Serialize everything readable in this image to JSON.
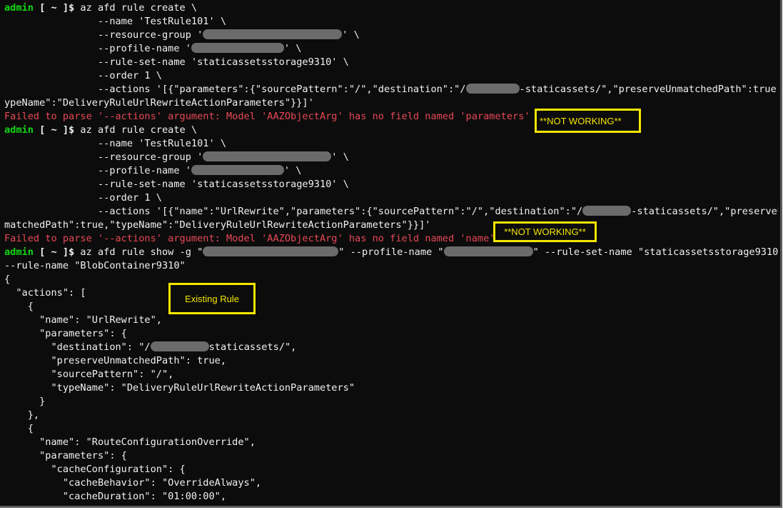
{
  "terminal": {
    "lines": [
      {
        "segments": [
          {
            "t": "admin",
            "c": "user"
          },
          {
            "t": " [ ~ ]$ ",
            "c": "prompt"
          },
          {
            "t": "az afd rule create \\"
          }
        ]
      },
      {
        "segments": [
          {
            "t": "                --name 'TestRule101' \\"
          }
        ]
      },
      {
        "segments": [
          {
            "t": "                --resource-group '"
          },
          {
            "redact": 195
          },
          {
            "t": "' \\"
          }
        ]
      },
      {
        "segments": [
          {
            "t": "                --profile-name '"
          },
          {
            "redact": 130
          },
          {
            "t": "' \\"
          }
        ]
      },
      {
        "segments": [
          {
            "t": "                --rule-set-name 'staticassetsstorage9310' \\"
          }
        ]
      },
      {
        "segments": [
          {
            "t": "                --order 1 \\"
          }
        ]
      },
      {
        "segments": [
          {
            "t": "                --actions '[{\"parameters\":{\"sourcePattern\":\"/\",\"destination\":\"/"
          },
          {
            "redact": 75
          },
          {
            "t": "-staticassets/\",\"preserveUnmatchedPath\":true,\"t"
          }
        ]
      },
      {
        "segments": [
          {
            "t": "ypeName\":\"DeliveryRuleUrlRewriteActionParameters\"}}]'"
          }
        ]
      },
      {
        "segments": [
          {
            "t": "Failed to parse '--actions' argument: Model 'AAZObjectArg' has no field named 'parameters'",
            "c": "err"
          }
        ]
      },
      {
        "segments": [
          {
            "t": "admin",
            "c": "user"
          },
          {
            "t": " [ ~ ]$ ",
            "c": "prompt"
          },
          {
            "t": "az afd rule create \\"
          }
        ]
      },
      {
        "segments": [
          {
            "t": "                --name 'TestRule101' \\"
          }
        ]
      },
      {
        "segments": [
          {
            "t": "                --resource-group '"
          },
          {
            "redact": 180
          },
          {
            "t": "' \\"
          }
        ]
      },
      {
        "segments": [
          {
            "t": "                --profile-name '"
          },
          {
            "redact": 130
          },
          {
            "t": "' \\"
          }
        ]
      },
      {
        "segments": [
          {
            "t": "                --rule-set-name 'staticassetsstorage9310' \\"
          }
        ]
      },
      {
        "segments": [
          {
            "t": "                --order 1 \\"
          }
        ]
      },
      {
        "segments": [
          {
            "t": "                --actions '[{\"name\":\"UrlRewrite\",\"parameters\":{\"sourcePattern\":\"/\",\"destination\":\"/"
          },
          {
            "redact": 68
          },
          {
            "t": "-staticassets/\",\"preserveUn"
          }
        ]
      },
      {
        "segments": [
          {
            "t": "matchedPath\":true,\"typeName\":\"DeliveryRuleUrlRewriteActionParameters\"}}]'"
          }
        ]
      },
      {
        "segments": [
          {
            "t": "Failed to parse '--actions' argument: Model 'AAZObjectArg' has no field named 'name'",
            "c": "err"
          }
        ]
      },
      {
        "segments": [
          {
            "t": "admin",
            "c": "user"
          },
          {
            "t": " [ ~ ]$ ",
            "c": "prompt"
          },
          {
            "t": "az afd rule show -g \""
          },
          {
            "redact": 190
          },
          {
            "t": "\" --profile-name \""
          },
          {
            "redact": 125
          },
          {
            "t": "\" --rule-set-name \"staticassetsstorage9310\""
          }
        ]
      },
      {
        "segments": [
          {
            "t": "--rule-name \"BlobContainer9310\""
          }
        ]
      },
      {
        "segments": [
          {
            "t": "{"
          }
        ]
      },
      {
        "segments": [
          {
            "t": "  \"actions\": ["
          }
        ]
      },
      {
        "segments": [
          {
            "t": "    {"
          }
        ]
      },
      {
        "segments": [
          {
            "t": "      \"name\": \"UrlRewrite\","
          }
        ]
      },
      {
        "segments": [
          {
            "t": "      \"parameters\": {"
          }
        ]
      },
      {
        "segments": [
          {
            "t": "        \"destination\": \"/"
          },
          {
            "redact": 82
          },
          {
            "t": "staticassets/\","
          }
        ]
      },
      {
        "segments": [
          {
            "t": "        \"preserveUnmatchedPath\": true,"
          }
        ]
      },
      {
        "segments": [
          {
            "t": "        \"sourcePattern\": \"/\","
          }
        ]
      },
      {
        "segments": [
          {
            "t": "        \"typeName\": \"DeliveryRuleUrlRewriteActionParameters\""
          }
        ]
      },
      {
        "segments": [
          {
            "t": "      }"
          }
        ]
      },
      {
        "segments": [
          {
            "t": "    },"
          }
        ]
      },
      {
        "segments": [
          {
            "t": "    {"
          }
        ]
      },
      {
        "segments": [
          {
            "t": "      \"name\": \"RouteConfigurationOverride\","
          }
        ]
      },
      {
        "segments": [
          {
            "t": "      \"parameters\": {"
          }
        ]
      },
      {
        "segments": [
          {
            "t": "        \"cacheConfiguration\": {"
          }
        ]
      },
      {
        "segments": [
          {
            "t": "          \"cacheBehavior\": \"OverrideAlways\","
          }
        ]
      },
      {
        "segments": [
          {
            "t": "          \"cacheDuration\": \"01:00:00\","
          }
        ]
      }
    ]
  },
  "annotations": {
    "not_working_1": "**NOT WORKING**",
    "not_working_2": "**NOT WORKING**",
    "existing_rule": "Existing Rule"
  },
  "colors": {
    "background": "#0c0c0c",
    "text": "#f2f2f2",
    "prompt_user": "#13d613",
    "error": "#e74856",
    "callout": "#f5e600",
    "redaction": "#6b6b6b"
  }
}
